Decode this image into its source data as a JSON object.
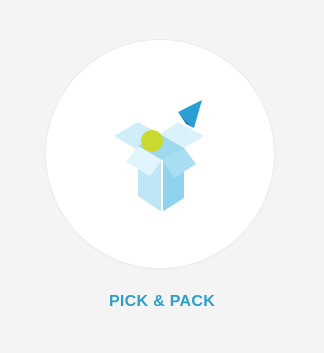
{
  "tile": {
    "label": "PICK & PACK",
    "icon": "open-box-icon",
    "colors": {
      "accent": "#2f9ec9",
      "box_light": "#bfe6f5",
      "box_mid": "#8fd3ee",
      "box_dark": "#5bbde6",
      "ball": "#c9d92f",
      "triangle": "#2a9fd6",
      "circle_bg": "#ffffff",
      "page_bg": "#f4f4f4"
    }
  }
}
